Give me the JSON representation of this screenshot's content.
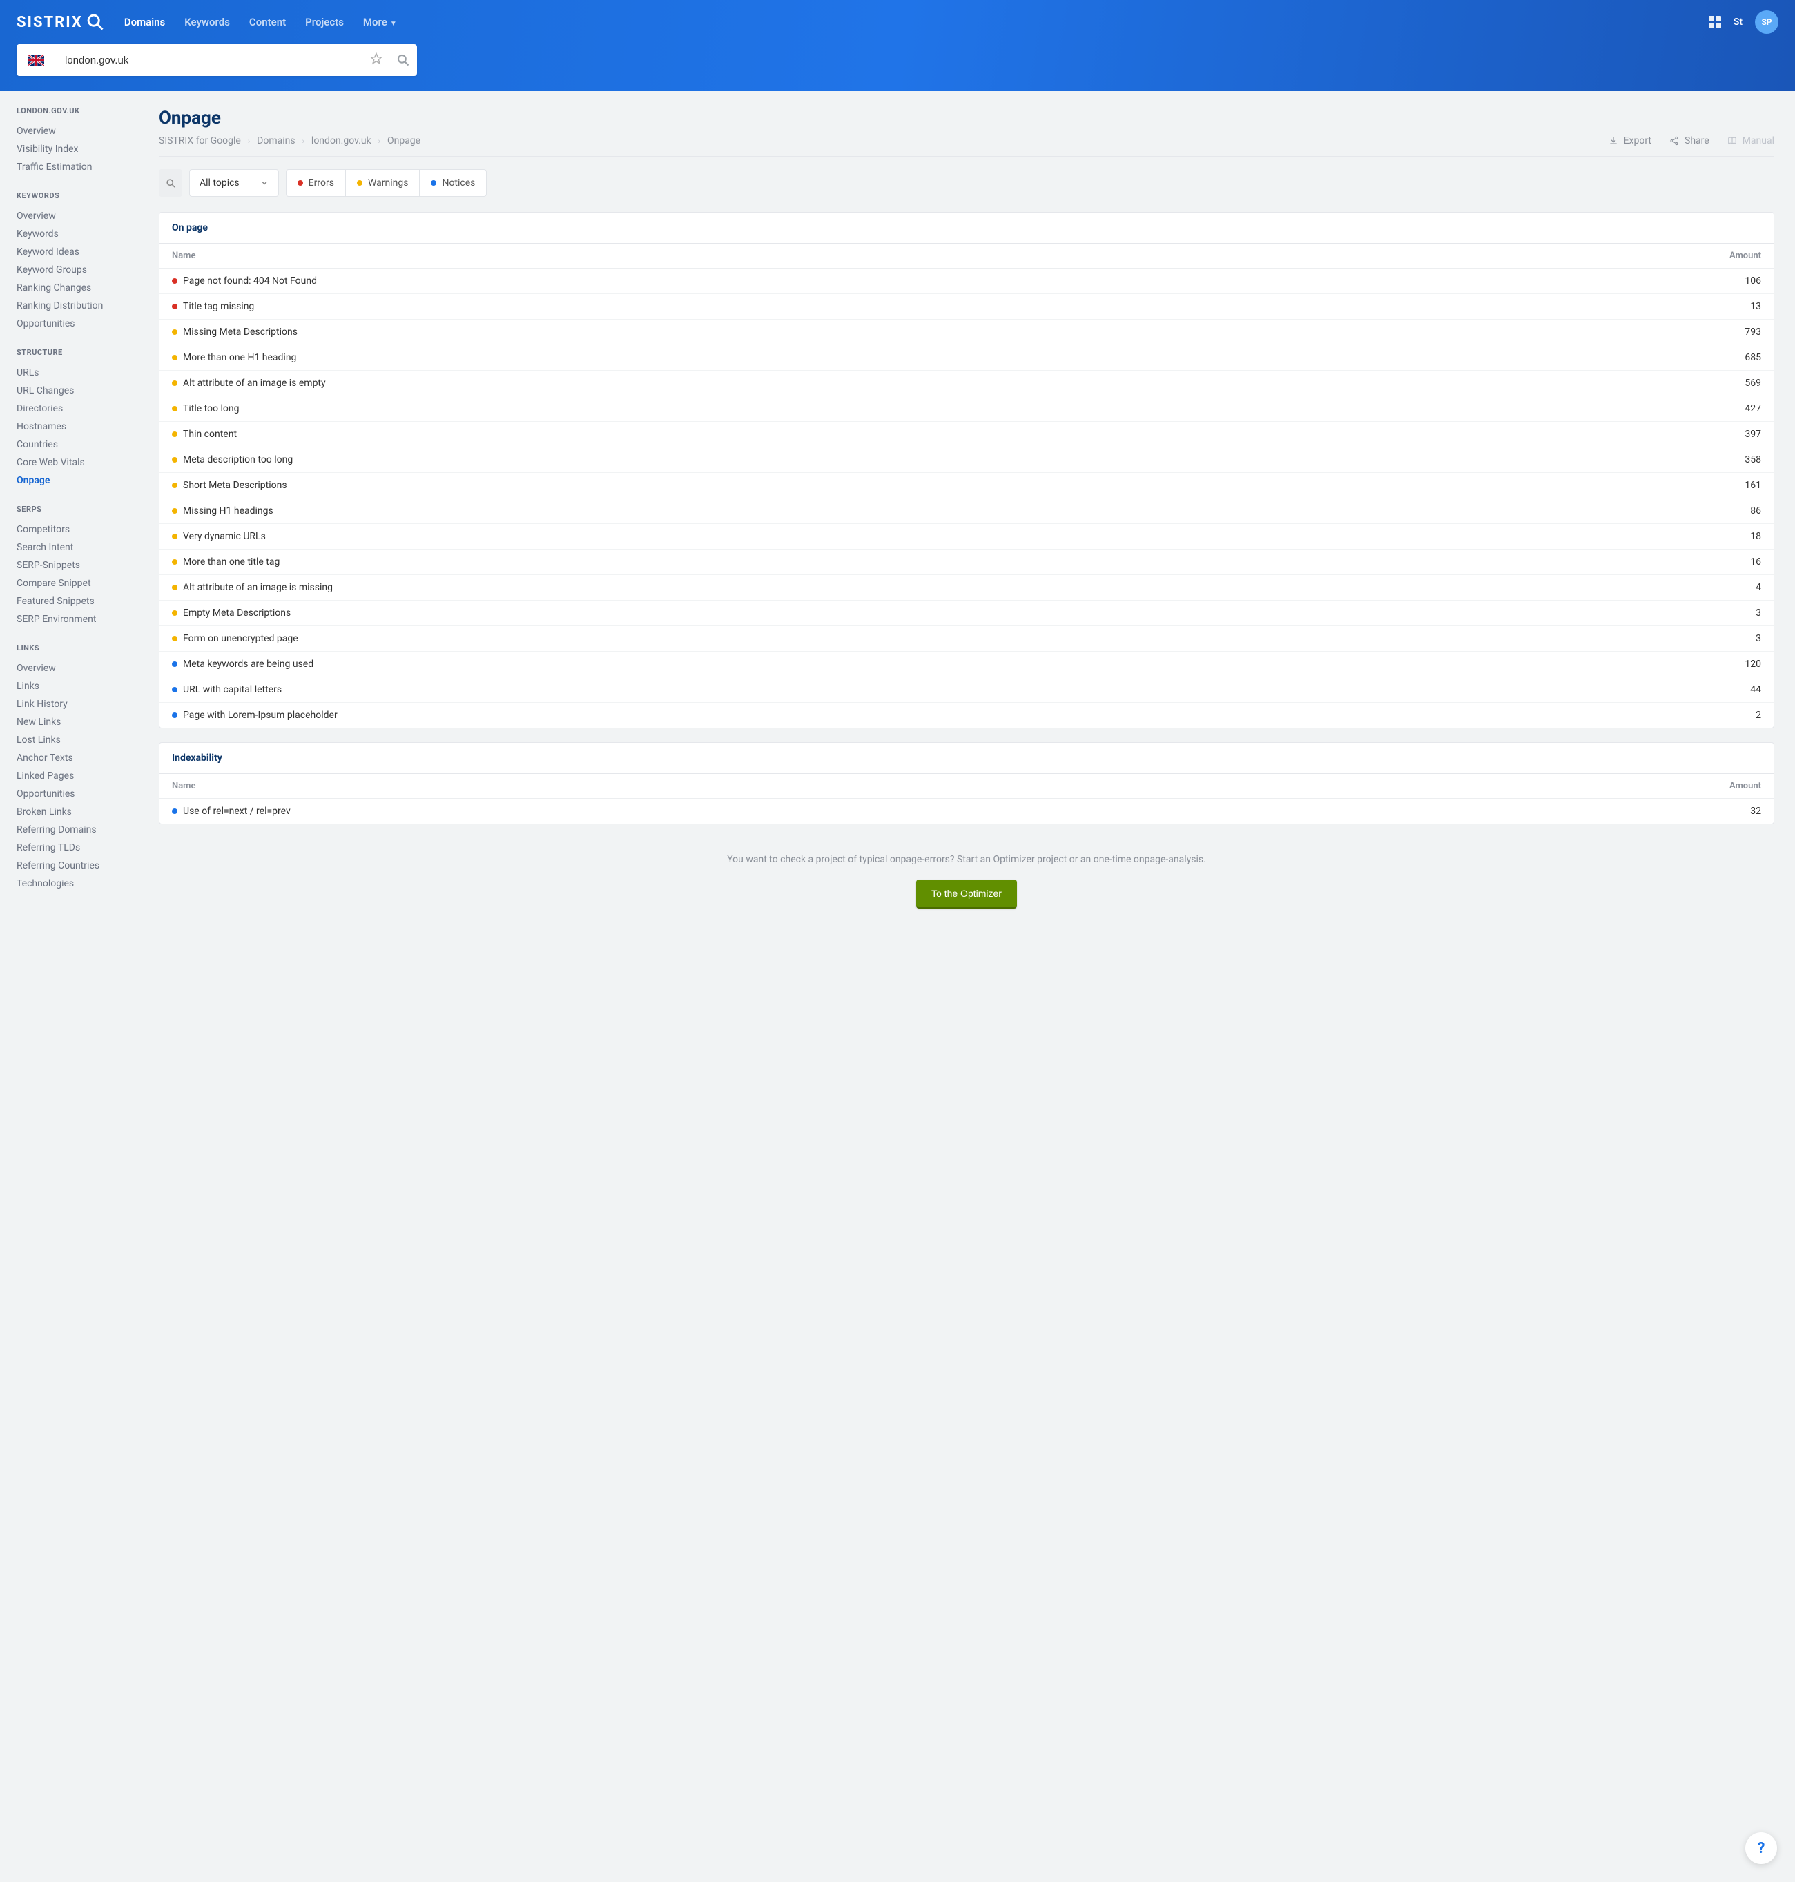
{
  "brand": "SISTRIX",
  "nav": {
    "items": [
      {
        "label": "Domains",
        "active": true
      },
      {
        "label": "Keywords",
        "active": false
      },
      {
        "label": "Content",
        "active": false
      },
      {
        "label": "Projects",
        "active": false
      },
      {
        "label": "More",
        "active": false,
        "chevron": true
      }
    ],
    "st": "St",
    "avatar": "SP"
  },
  "search": {
    "value": "london.gov.uk"
  },
  "sidebar": [
    {
      "title": "LONDON.GOV.UK",
      "items": [
        {
          "label": "Overview"
        },
        {
          "label": "Visibility Index"
        },
        {
          "label": "Traffic Estimation"
        }
      ]
    },
    {
      "title": "KEYWORDS",
      "items": [
        {
          "label": "Overview"
        },
        {
          "label": "Keywords"
        },
        {
          "label": "Keyword Ideas"
        },
        {
          "label": "Keyword Groups"
        },
        {
          "label": "Ranking Changes"
        },
        {
          "label": "Ranking Distribution"
        },
        {
          "label": "Opportunities"
        }
      ]
    },
    {
      "title": "STRUCTURE",
      "items": [
        {
          "label": "URLs"
        },
        {
          "label": "URL Changes"
        },
        {
          "label": "Directories"
        },
        {
          "label": "Hostnames"
        },
        {
          "label": "Countries"
        },
        {
          "label": "Core Web Vitals"
        },
        {
          "label": "Onpage",
          "active": true
        }
      ]
    },
    {
      "title": "SERPS",
      "items": [
        {
          "label": "Competitors"
        },
        {
          "label": "Search Intent"
        },
        {
          "label": "SERP-Snippets"
        },
        {
          "label": "Compare Snippet"
        },
        {
          "label": "Featured Snippets"
        },
        {
          "label": "SERP Environment"
        }
      ]
    },
    {
      "title": "LINKS",
      "items": [
        {
          "label": "Overview"
        },
        {
          "label": "Links"
        },
        {
          "label": "Link History"
        },
        {
          "label": "New Links"
        },
        {
          "label": "Lost Links"
        },
        {
          "label": "Anchor Texts"
        },
        {
          "label": "Linked Pages"
        },
        {
          "label": "Opportunities"
        },
        {
          "label": "Broken Links"
        },
        {
          "label": "Referring Domains"
        },
        {
          "label": "Referring TLDs"
        },
        {
          "label": "Referring Countries"
        },
        {
          "label": "Technologies"
        }
      ]
    }
  ],
  "page": {
    "title": "Onpage",
    "breadcrumb": [
      "SISTRIX for Google",
      "Domains",
      "london.gov.uk",
      "Onpage"
    ],
    "actions": {
      "export": "Export",
      "share": "Share",
      "manual": "Manual"
    }
  },
  "filters": {
    "dropdown": "All topics",
    "segs": [
      {
        "label": "Errors",
        "dot": "error"
      },
      {
        "label": "Warnings",
        "dot": "warning"
      },
      {
        "label": "Notices",
        "dot": "notice"
      }
    ]
  },
  "tables": [
    {
      "title": "On page",
      "head": {
        "name": "Name",
        "amount": "Amount"
      },
      "rows": [
        {
          "dot": "error",
          "name": "Page not found: 404 Not Found",
          "amount": 106
        },
        {
          "dot": "error",
          "name": "Title tag missing",
          "amount": 13
        },
        {
          "dot": "warning",
          "name": "Missing Meta Descriptions",
          "amount": 793
        },
        {
          "dot": "warning",
          "name": "More than one H1 heading",
          "amount": 685
        },
        {
          "dot": "warning",
          "name": "Alt attribute of an image is empty",
          "amount": 569
        },
        {
          "dot": "warning",
          "name": "Title too long",
          "amount": 427
        },
        {
          "dot": "warning",
          "name": "Thin content",
          "amount": 397
        },
        {
          "dot": "warning",
          "name": "Meta description too long",
          "amount": 358
        },
        {
          "dot": "warning",
          "name": "Short Meta Descriptions",
          "amount": 161
        },
        {
          "dot": "warning",
          "name": "Missing H1 headings",
          "amount": 86
        },
        {
          "dot": "warning",
          "name": "Very dynamic URLs",
          "amount": 18
        },
        {
          "dot": "warning",
          "name": "More than one title tag",
          "amount": 16
        },
        {
          "dot": "warning",
          "name": "Alt attribute of an image is missing",
          "amount": 4
        },
        {
          "dot": "warning",
          "name": "Empty Meta Descriptions",
          "amount": 3
        },
        {
          "dot": "warning",
          "name": "Form on unencrypted page",
          "amount": 3
        },
        {
          "dot": "notice",
          "name": "Meta keywords are being used",
          "amount": 120
        },
        {
          "dot": "notice",
          "name": "URL with capital letters",
          "amount": 44
        },
        {
          "dot": "notice",
          "name": "Page with Lorem-Ipsum placeholder",
          "amount": 2
        }
      ]
    },
    {
      "title": "Indexability",
      "head": {
        "name": "Name",
        "amount": "Amount"
      },
      "rows": [
        {
          "dot": "notice",
          "name": "Use of rel=next / rel=prev",
          "amount": 32
        }
      ]
    }
  ],
  "cta": {
    "text": "You want to check a project of typical onpage-errors? Start an Optimizer project or an one-time onpage-analysis.",
    "button": "To the Optimizer"
  },
  "help": "?"
}
